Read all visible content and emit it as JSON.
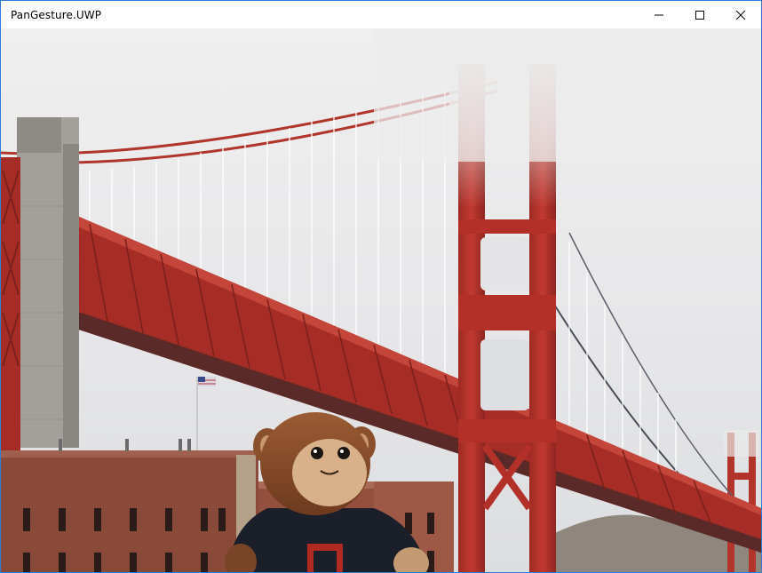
{
  "window": {
    "title": "PanGesture.UWP"
  },
  "controls": {
    "minimize": "minimize-icon",
    "maximize": "maximize-icon",
    "close": "close-icon"
  },
  "image": {
    "subject": "golden-gate-bridge-with-plush-monkey",
    "colors": {
      "bridge_red": "#b8322a",
      "fog": "#e9e9ea",
      "brick": "#8a4a3a",
      "monkey_fur": "#8a4f2c",
      "monkey_face": "#d8b18a",
      "shirt": "#1a1f2a"
    }
  }
}
